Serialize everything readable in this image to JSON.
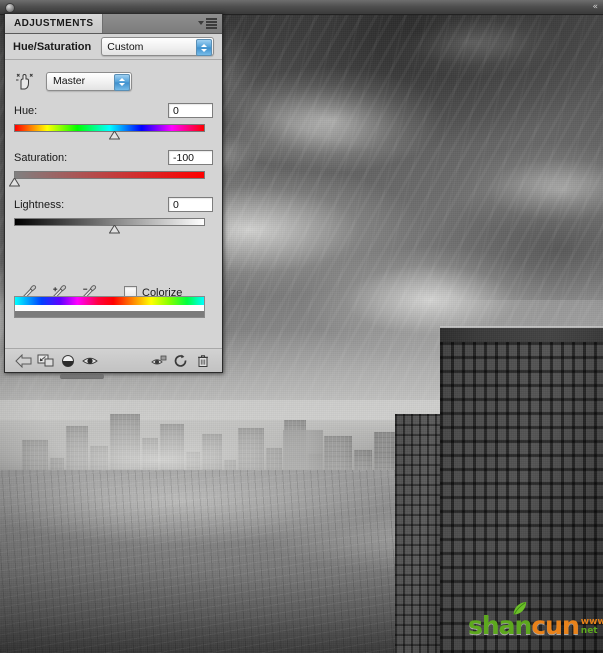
{
  "window": {
    "collapse_icon": "chevrons-left-icon",
    "titlebar_dot": "window-control-dot"
  },
  "panel": {
    "tab_label": "ADJUSTMENTS",
    "menu_icon": "panel-menu-icon",
    "title": "Hue/Saturation",
    "preset": {
      "value": "Custom",
      "stepper_icon": "updown-stepper-icon"
    },
    "channel": {
      "target_adjust_icon": "on-image-adjust-hand-icon",
      "value": "Master",
      "stepper_icon": "updown-stepper-icon"
    },
    "sliders": [
      {
        "name": "hue",
        "label": "Hue:",
        "value": "0",
        "thumb_pct": 50,
        "track": "hue-gradient"
      },
      {
        "name": "saturation",
        "label": "Saturation:",
        "value": "-100",
        "thumb_pct": 0,
        "track": "gray-to-red-gradient"
      },
      {
        "name": "lightness",
        "label": "Lightness:",
        "value": "0",
        "thumb_pct": 50,
        "track": "black-to-white-gradient"
      }
    ],
    "tools": {
      "eyedropper_icon": "eyedropper-icon",
      "eyedropper_add_icon": "eyedropper-plus-icon",
      "eyedropper_subtract_icon": "eyedropper-minus-icon",
      "colorize_label": "Colorize",
      "colorize_checked": false
    },
    "spectrum": {
      "top_bar": "hue-spectrum-bar",
      "bottom_bar": "result-range-bar"
    },
    "footer_buttons": [
      {
        "name": "return-to-adjustment-list-button",
        "icon": "left-arrow-icon"
      },
      {
        "name": "clip-to-layer-button",
        "icon": "clip-to-layer-icon"
      },
      {
        "name": "toggle-layer-mask-button",
        "icon": "half-circle-icon"
      },
      {
        "name": "toggle-layer-visibility-button",
        "icon": "eye-icon"
      },
      {
        "name": "view-previous-state-button",
        "icon": "eye-previous-icon"
      },
      {
        "name": "reset-adjustment-button",
        "icon": "reset-circle-icon"
      },
      {
        "name": "delete-adjustment-layer-button",
        "icon": "trash-icon"
      }
    ]
  },
  "image": {
    "subject": "black-and-white cityscape with dramatic clouds and fog",
    "watermark": {
      "text_green": "shan",
      "text_orange": "cun",
      "side_line1": "www",
      "side_line2": "net",
      "leaf_icon": "leaf-icon",
      "color_green": "#5da81e",
      "color_orange": "#e8821a"
    }
  }
}
